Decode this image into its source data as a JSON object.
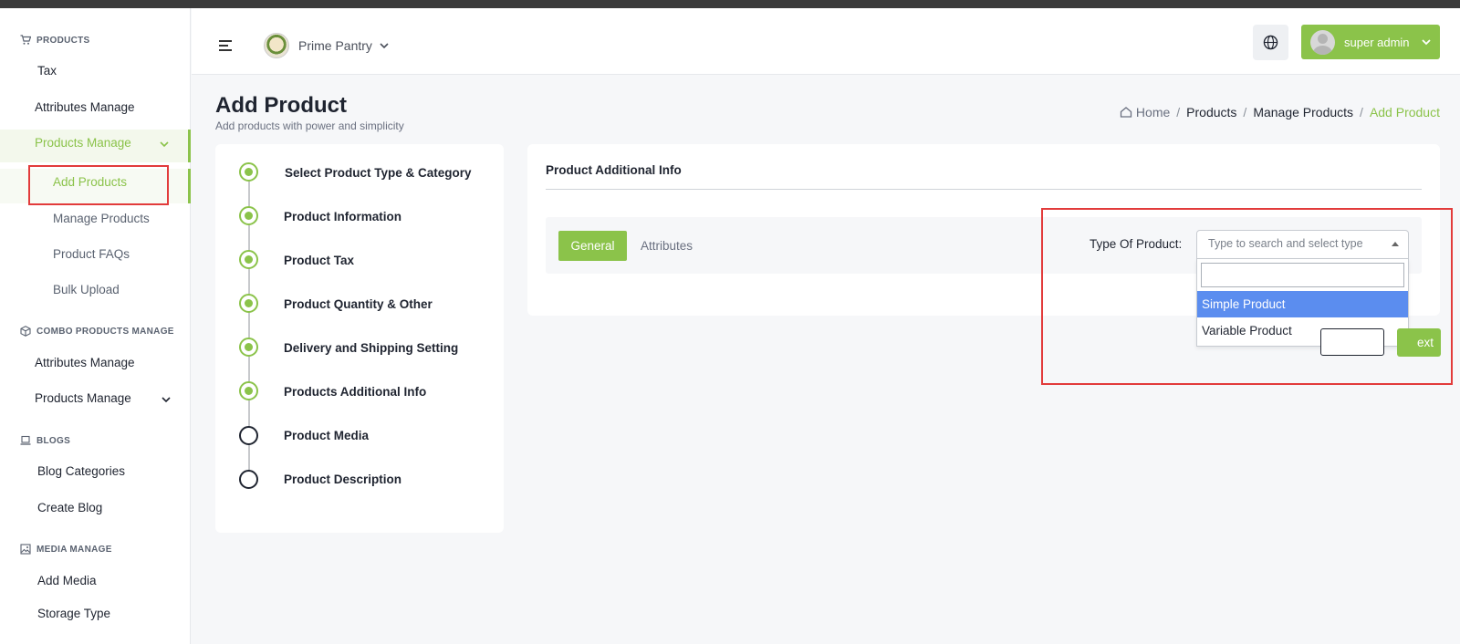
{
  "sidebar": {
    "sections": {
      "products": "PRODUCTS",
      "combo": "COMBO PRODUCTS MANAGE",
      "blogs": "BLOGS",
      "media": "MEDIA MANAGE"
    },
    "items": {
      "tax": "Tax",
      "attributes_manage": "Attributes Manage",
      "products_manage": "Products Manage",
      "add_products": "Add Products",
      "manage_products": "Manage Products",
      "product_faqs": "Product FAQs",
      "bulk_upload": "Bulk Upload",
      "combo_attributes_manage": "Attributes Manage",
      "combo_products_manage": "Products Manage",
      "blog_categories": "Blog Categories",
      "create_blog": "Create Blog",
      "add_media": "Add Media",
      "storage_type": "Storage Type"
    }
  },
  "header": {
    "store_name": "Prime Pantry",
    "user_name": "super admin"
  },
  "page": {
    "title": "Add Product",
    "subtitle": "Add products with power and simplicity"
  },
  "breadcrumb": [
    "Home",
    "Products",
    "Manage Products",
    "Add Product"
  ],
  "steps": [
    {
      "label": "Select Product Type & Category",
      "status": "done"
    },
    {
      "label": "Product Information",
      "status": "done"
    },
    {
      "label": "Product Tax",
      "status": "done"
    },
    {
      "label": "Product Quantity & Other",
      "status": "done"
    },
    {
      "label": "Delivery and Shipping Setting",
      "status": "done"
    },
    {
      "label": "Products Additional Info",
      "status": "done"
    },
    {
      "label": "Product Media",
      "status": "todo"
    },
    {
      "label": "Product Description",
      "status": "todo"
    }
  ],
  "info": {
    "title": "Product Additional Info",
    "tabs": {
      "general": "General",
      "attributes": "Attributes"
    },
    "type_label": "Type Of Product:",
    "type_placeholder": "Type to search and select type",
    "options": [
      "Simple Product",
      "Variable Product"
    ],
    "highlighted_option": "Simple Product",
    "next_label": "Next"
  },
  "colors": {
    "accent": "#8bc34a",
    "highlight": "#5b8def",
    "annotation": "#e23b3b"
  }
}
